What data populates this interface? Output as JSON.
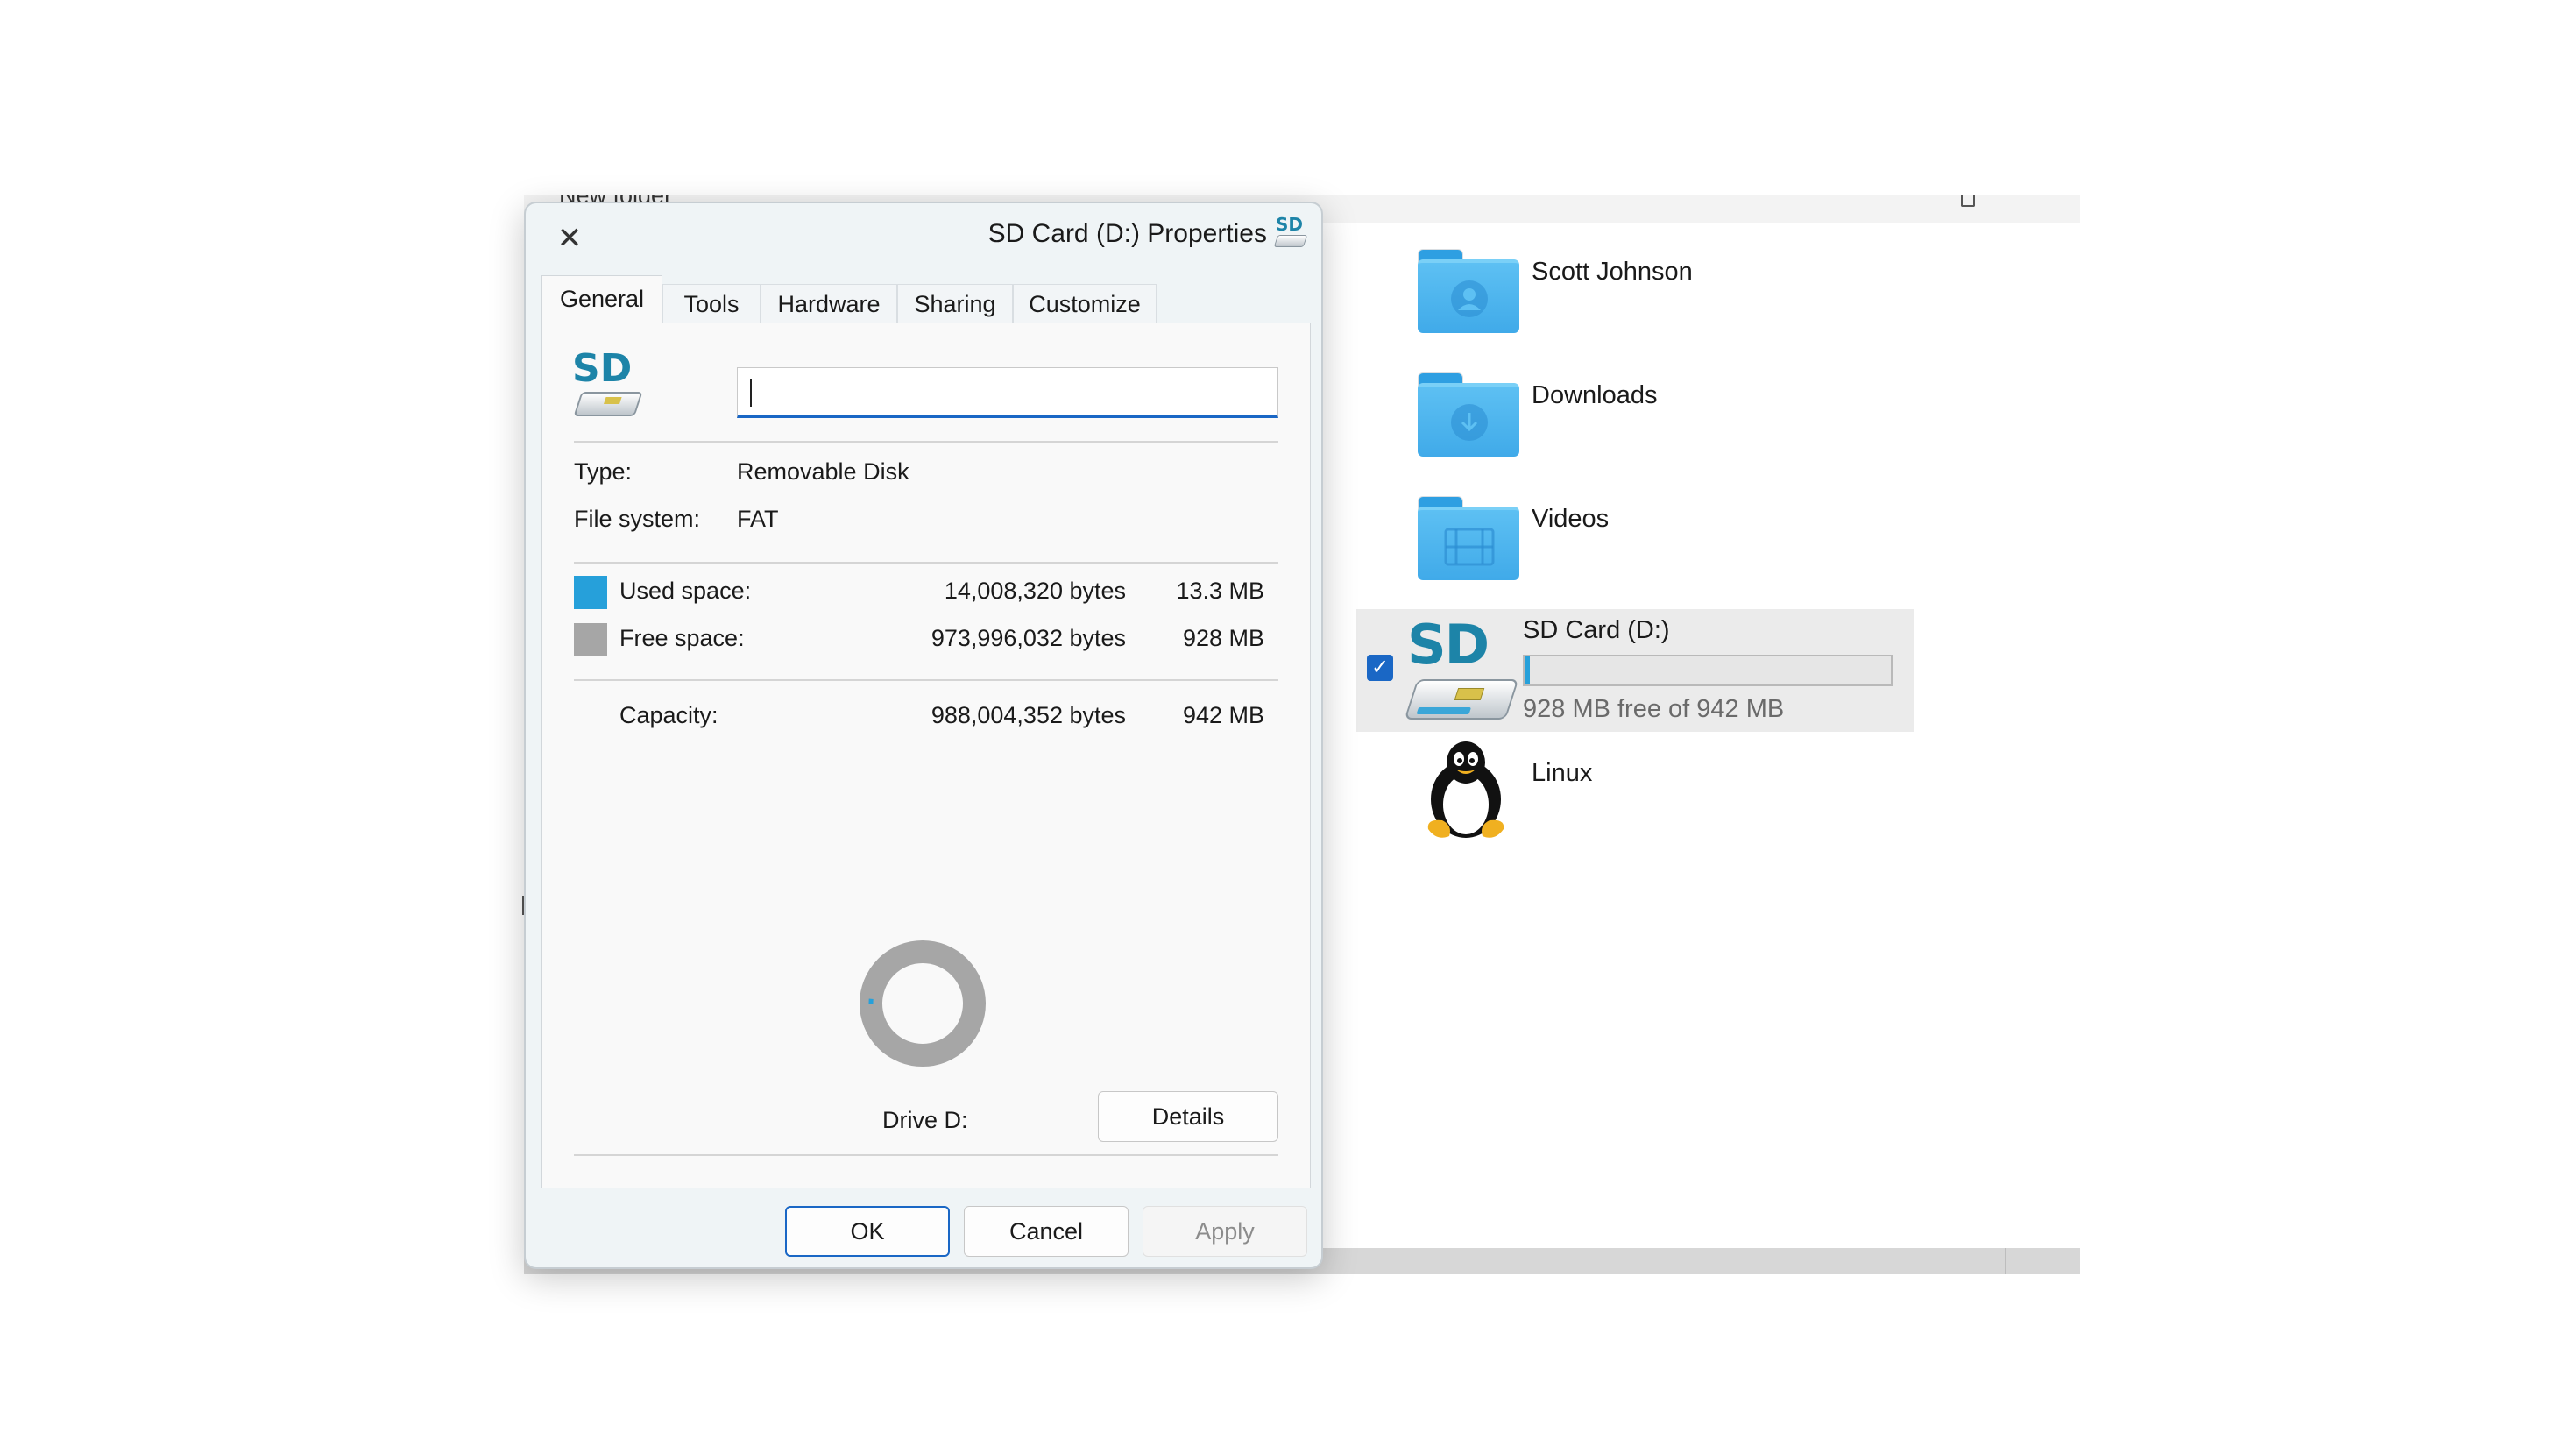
{
  "explorer": {
    "header_peek": "New folder",
    "items": [
      {
        "label": "Scott Johnson",
        "icon": "user-folder-icon"
      },
      {
        "label": "Downloads",
        "icon": "downloads-folder-icon"
      },
      {
        "label": "Videos",
        "icon": "videos-folder-icon"
      },
      {
        "label": "SD Card (D:)",
        "icon": "sd-card-drive-icon",
        "selected": true,
        "free_text": "928 MB free of 942 MB",
        "used_fraction": 0.014
      },
      {
        "label": "Linux",
        "icon": "linux-penguin-icon"
      }
    ]
  },
  "dialog": {
    "title": "SD Card (D:) Properties",
    "tabs": [
      "General",
      "Tools",
      "Hardware",
      "Sharing",
      "Customize"
    ],
    "active_tab": "General",
    "name_value": "",
    "type_label": "Type:",
    "type_value": "Removable Disk",
    "fs_label": "File system:",
    "fs_value": "FAT",
    "used_label": "Used space:",
    "used_bytes": "14,008,320 bytes",
    "used_size": "13.3 MB",
    "free_label": "Free space:",
    "free_bytes": "973,996,032 bytes",
    "free_size": "928 MB",
    "capacity_label": "Capacity:",
    "capacity_bytes": "988,004,352 bytes",
    "capacity_size": "942 MB",
    "drive_label": "Drive D:",
    "details_button": "Details",
    "ok_button": "OK",
    "cancel_button": "Cancel",
    "apply_button": "Apply",
    "used_fraction": 0.0142,
    "colors": {
      "used": "#26a0da",
      "free": "#a6a6a6",
      "accent": "#1a67c5"
    }
  }
}
